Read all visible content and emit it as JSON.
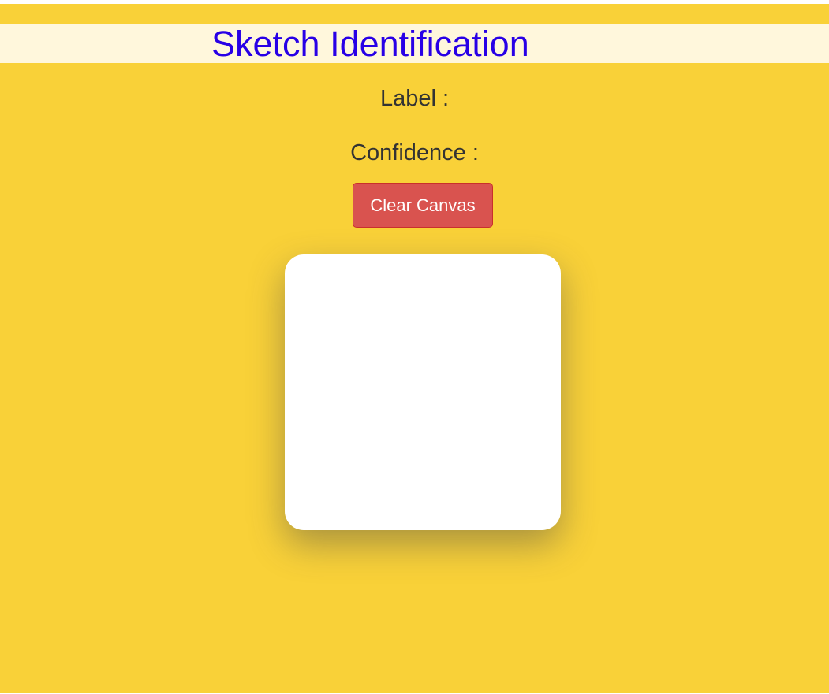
{
  "header": {
    "title": "Sketch Identification"
  },
  "results": {
    "label_text": "Label :",
    "confidence_text": "Confidence :"
  },
  "controls": {
    "clear_label": "Clear Canvas"
  },
  "colors": {
    "background": "#f9d138",
    "title_bar": "#fff7dc",
    "title_text": "#2800e6",
    "body_text": "#333333",
    "clear_button": "#d9534f",
    "canvas": "#ffffff"
  }
}
